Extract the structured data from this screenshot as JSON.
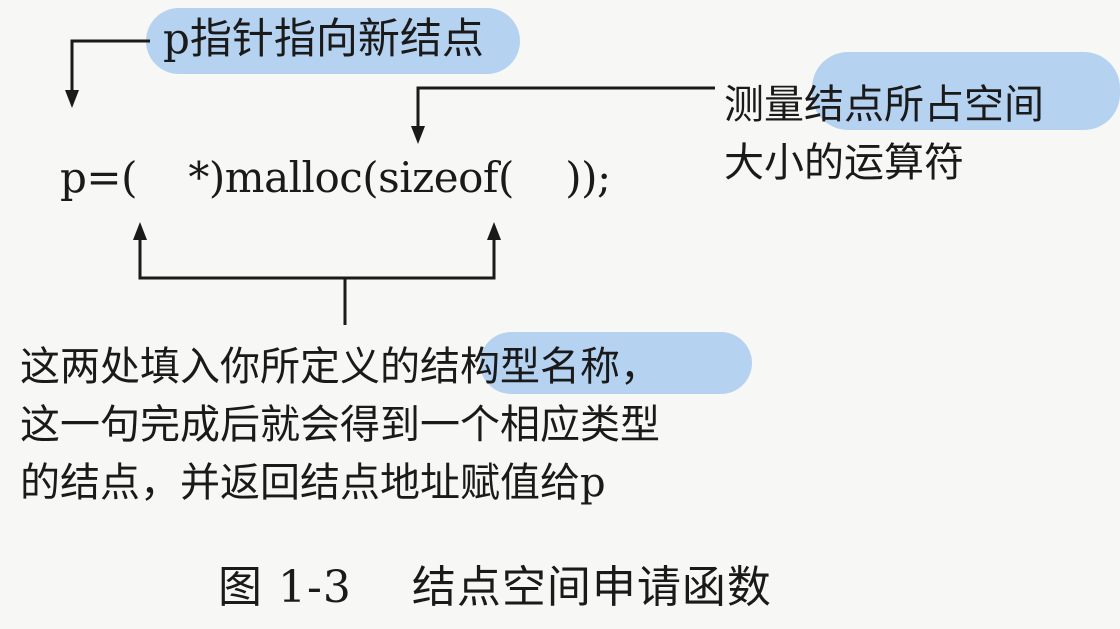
{
  "annotations": {
    "pointer_note": "p指针指向新结点",
    "sizeof_note_line1": "测量结点所占空间",
    "sizeof_note_line2": "大小的运算符",
    "type_note_line1": "这两处填入你所定义的结构型名称，",
    "type_note_line2": "这一句完成后就会得到一个相应类型",
    "type_note_line3": "的结点，并返回结点地址赋值给p"
  },
  "code": {
    "statement": "p=(    *)malloc(sizeof(    ));"
  },
  "caption": {
    "number": "图 1-3",
    "title": "结点空间申请函数"
  },
  "colors": {
    "highlight": "#a9cdf0",
    "ink": "#1a1a1a",
    "background": "#f7f7f5"
  }
}
